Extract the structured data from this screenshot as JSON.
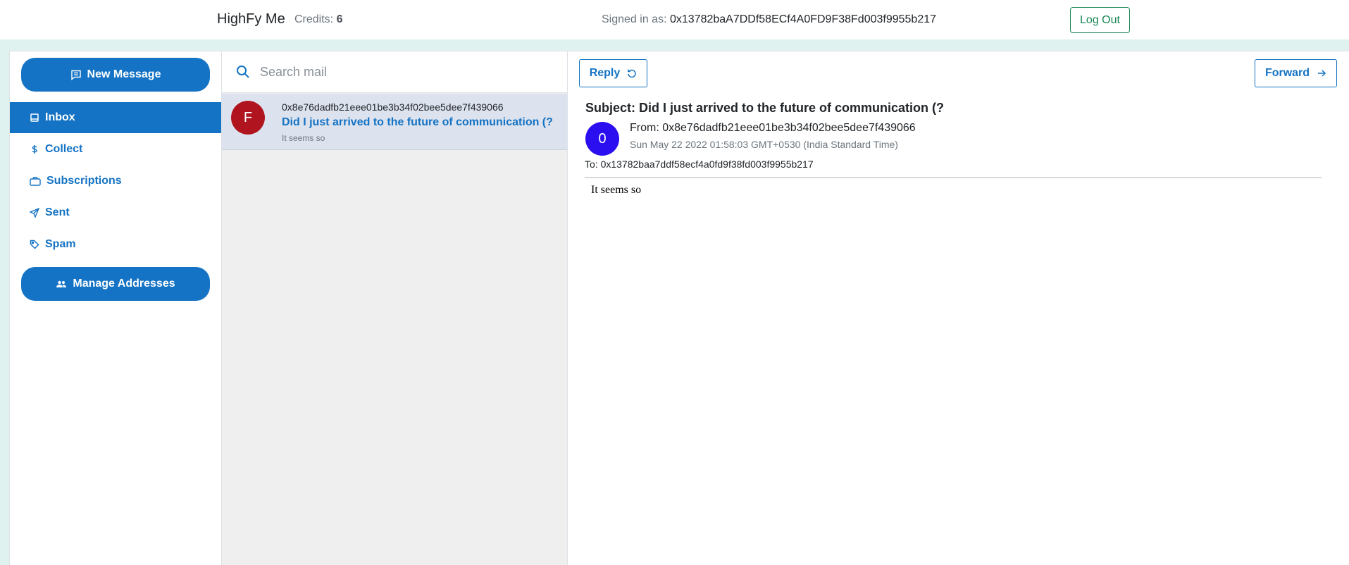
{
  "header": {
    "brand": "HighFy Me",
    "credits_label": "Credits:",
    "credits_value": "6",
    "signed_in_label": "Signed in as:",
    "signed_in_address": "0x13782baA7DDf58ECf4A0FD9F38Fd003f9955b217",
    "logout_label": "Log Out"
  },
  "sidebar": {
    "new_message_label": "New Message",
    "items": [
      {
        "label": "Inbox",
        "icon": "inbox-icon",
        "active": true
      },
      {
        "label": "Collect",
        "icon": "dollar-icon",
        "active": false
      },
      {
        "label": "Subscriptions",
        "icon": "briefcase-icon",
        "active": false
      },
      {
        "label": "Sent",
        "icon": "send-icon",
        "active": false
      },
      {
        "label": "Spam",
        "icon": "tag-icon",
        "active": false
      }
    ],
    "manage_addresses_label": "Manage Addresses"
  },
  "search": {
    "placeholder": "Search mail",
    "value": ""
  },
  "mail_list": [
    {
      "avatar_letter": "F",
      "from": "0x8e76dadfb21eee01be3b34f02bee5dee7f439066",
      "subject": "Did I just arrived to the future of communication (?",
      "preview": "It seems so"
    }
  ],
  "reader": {
    "reply_label": "Reply",
    "forward_label": "Forward",
    "subject": "Subject: Did I just arrived to the future of communication (?",
    "avatar_letter": "0",
    "from": "From: 0x8e76dadfb21eee01be3b34f02bee5dee7f439066",
    "date": "Sun May 22 2022 01:58:03 GMT+0530 (India Standard Time)",
    "to": "To: 0x13782baa7ddf58ecf4a0fd9f38fd003f9955b217",
    "body": "It seems so"
  },
  "colors": {
    "accent": "#1473c4",
    "logout": "#198754",
    "avatar_f": "#b0151f",
    "avatar_o": "#2b0ff0",
    "page_bg": "#e0f2ef"
  }
}
